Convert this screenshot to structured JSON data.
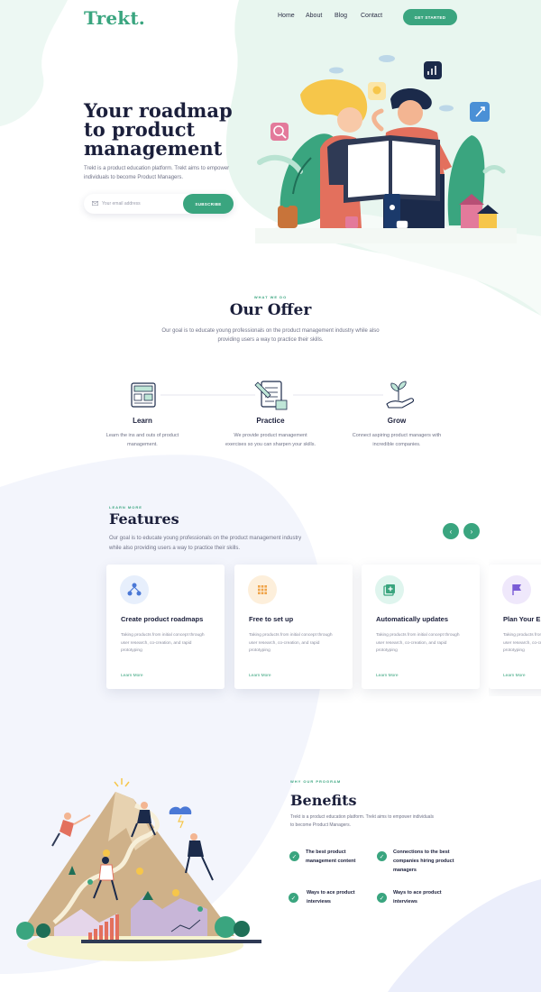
{
  "brand": {
    "logo": "Trekt.",
    "accent": "#3aa57f",
    "dark": "#1b1f3b"
  },
  "nav": {
    "items": [
      "Home",
      "About",
      "Blog",
      "Contact"
    ],
    "cta": "GET STARTED"
  },
  "hero": {
    "title_lines": [
      "Your roadmap",
      "to product",
      "management"
    ],
    "description": "Trekt is a product education platform. Trekt aims to empower individuals to become Product Managers.",
    "email_placeholder": "Your email address",
    "subscribe_label": "SUBSCRIBE"
  },
  "offer": {
    "eyebrow": "WHAT WE DO",
    "title": "Our Offer",
    "description": "Our goal is to educate young professionals on the product management industry while also providing users a way to practice their skills.",
    "steps": [
      {
        "title": "Learn",
        "description": "Learn the ins and outs of product management.",
        "icon": "learn-board-icon"
      },
      {
        "title": "Practice",
        "description": "We provide product management exercises so you can sharpen your skills.",
        "icon": "document-pen-icon"
      },
      {
        "title": "Grow",
        "description": "Connect aspiring product managers with incredible companies.",
        "icon": "hand-plant-icon"
      }
    ]
  },
  "features": {
    "eyebrow": "LEARN MORE",
    "title": "Features",
    "description": "Our goal is to educate young professionals on the product management industry while also providing users a way to practice their skills.",
    "prev_icon": "chevron-left-icon",
    "next_icon": "chevron-right-icon",
    "cards": [
      {
        "title": "Create product roadmaps",
        "description": "Taking products from initial concept through user research, co-creation, and rapid prototyping",
        "link": "Learn More",
        "icon": "hierarchy-icon",
        "icon_bg": "#e7effc",
        "icon_color": "#4a78d6"
      },
      {
        "title": "Free to set up",
        "description": "Taking products from initial concept through user research, co-creation, and rapid prototyping",
        "link": "Learn More",
        "icon": "grid-dots-icon",
        "icon_bg": "#fdefdb",
        "icon_color": "#f0a449"
      },
      {
        "title": "Automatically updates",
        "description": "Taking products from initial concept through user research, co-creation, and rapid prototyping",
        "link": "Learn More",
        "icon": "add-square-icon",
        "icon_bg": "#dff5ee",
        "icon_color": "#3aa57f"
      },
      {
        "title": "Plan Your E",
        "description": "Taking products from initial concept through user research, co-creation, and rapid prototyping",
        "link": "Learn More",
        "icon": "flag-icon",
        "icon_bg": "#efe8fb",
        "icon_color": "#7a5cd6"
      }
    ]
  },
  "benefits": {
    "eyebrow": "WHY OUR PROGRAM",
    "title": "Benefits",
    "description": "Trekt is a product education platform. Trekt aims to empower individuals to become Product Managers.",
    "items": [
      "The best product management content",
      "Connections to the best companies hiring product managers",
      "Ways to ace product interviews",
      "Ways to ace product interviews"
    ]
  }
}
